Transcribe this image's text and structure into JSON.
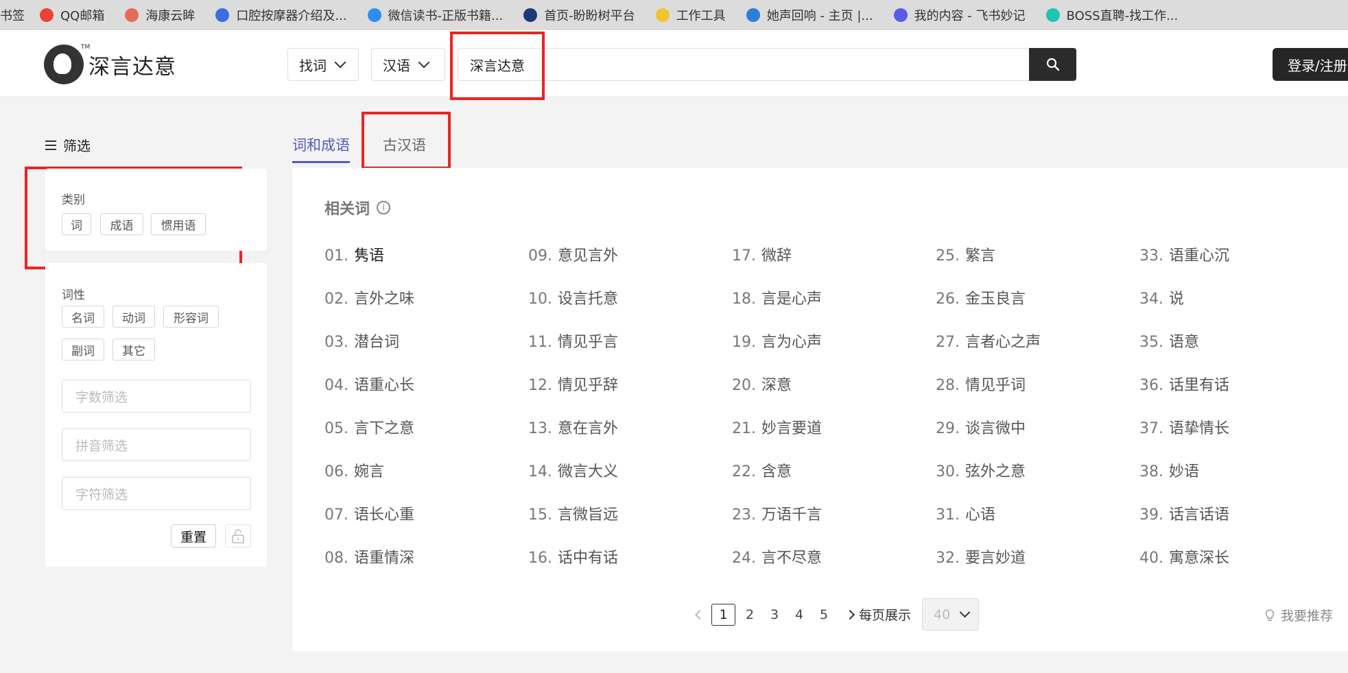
{
  "bookmarks": [
    {
      "label": "书签",
      "icon": "none",
      "color": ""
    },
    {
      "label": "QQ邮箱",
      "icon": "qq-mail-icon",
      "color": "#ea4335"
    },
    {
      "label": "海康云眸",
      "icon": "cloud-icon",
      "color": "#e56b5b"
    },
    {
      "label": "口腔按摩器介绍及...",
      "icon": "music-note-icon",
      "color": "#3b6fe0"
    },
    {
      "label": "微信读书-正版书籍...",
      "icon": "wechat-read-icon",
      "color": "#2e8ef0"
    },
    {
      "label": "首页-盼盼树平台",
      "icon": "robot-icon",
      "color": "#1c3a7a"
    },
    {
      "label": "工作工具",
      "icon": "folder-icon",
      "color": "#f2c230"
    },
    {
      "label": "她声回响 - 主页 |...",
      "icon": "leaf-icon",
      "color": "#2c7fd6"
    },
    {
      "label": "我的内容 - 飞书妙记",
      "icon": "feishu-icon",
      "color": "#5b5ce6"
    },
    {
      "label": "BOSS直聘-找工作...",
      "icon": "boss-icon",
      "color": "#20c4b0"
    }
  ],
  "header": {
    "logo_text": "深言达意",
    "logo_tm": "TM",
    "mode_select": "找词",
    "lang_select": "汉语",
    "search_value": "深言达意",
    "login_label": "登录/注册"
  },
  "sidebar": {
    "title": "筛选",
    "category": {
      "label": "类别",
      "tags": [
        "词",
        "成语",
        "惯用语"
      ]
    },
    "pos": {
      "label": "词性",
      "tags": [
        "名词",
        "动词",
        "形容词",
        "副词",
        "其它"
      ]
    },
    "inputs": {
      "char_count": "字数筛选",
      "pinyin": "拼音筛选",
      "char": "字符筛选"
    },
    "reset_label": "重置"
  },
  "tabs": {
    "active": "词和成语",
    "inactive": "古汉语"
  },
  "main": {
    "section_title": "相关词",
    "info_glyph": "i",
    "words": [
      {
        "num": "01.",
        "text": "隽语"
      },
      {
        "num": "02.",
        "text": "言外之味"
      },
      {
        "num": "03.",
        "text": "潜台词"
      },
      {
        "num": "04.",
        "text": "语重心长"
      },
      {
        "num": "05.",
        "text": "言下之意"
      },
      {
        "num": "06.",
        "text": "婉言"
      },
      {
        "num": "07.",
        "text": "语长心重"
      },
      {
        "num": "08.",
        "text": "语重情深"
      },
      {
        "num": "09.",
        "text": "意见言外"
      },
      {
        "num": "10.",
        "text": "设言托意"
      },
      {
        "num": "11.",
        "text": "情见乎言"
      },
      {
        "num": "12.",
        "text": "情见乎辞"
      },
      {
        "num": "13.",
        "text": "意在言外"
      },
      {
        "num": "14.",
        "text": "微言大义"
      },
      {
        "num": "15.",
        "text": "言微旨远"
      },
      {
        "num": "16.",
        "text": "话中有话"
      },
      {
        "num": "17.",
        "text": "微辞"
      },
      {
        "num": "18.",
        "text": "言是心声"
      },
      {
        "num": "19.",
        "text": "言为心声"
      },
      {
        "num": "20.",
        "text": "深意"
      },
      {
        "num": "21.",
        "text": "妙言要道"
      },
      {
        "num": "22.",
        "text": "含意"
      },
      {
        "num": "23.",
        "text": "万语千言"
      },
      {
        "num": "24.",
        "text": "言不尽意"
      },
      {
        "num": "25.",
        "text": "繁言"
      },
      {
        "num": "26.",
        "text": "金玉良言"
      },
      {
        "num": "27.",
        "text": "言者心之声"
      },
      {
        "num": "28.",
        "text": "情见乎词"
      },
      {
        "num": "29.",
        "text": "谈言微中"
      },
      {
        "num": "30.",
        "text": "弦外之意"
      },
      {
        "num": "31.",
        "text": "心语"
      },
      {
        "num": "32.",
        "text": "要言妙道"
      },
      {
        "num": "33.",
        "text": "语重心沉"
      },
      {
        "num": "34.",
        "text": "说"
      },
      {
        "num": "35.",
        "text": "语意"
      },
      {
        "num": "36.",
        "text": "话里有话"
      },
      {
        "num": "37.",
        "text": "语挚情长"
      },
      {
        "num": "38.",
        "text": "妙语"
      },
      {
        "num": "39.",
        "text": "话言话语"
      },
      {
        "num": "40.",
        "text": "寓意深长"
      }
    ]
  },
  "pagination": {
    "pages": [
      "1",
      "2",
      "3",
      "4",
      "5"
    ],
    "current": "1",
    "per_page_label": "每页展示",
    "per_page_value": "40"
  },
  "recommend_label": "我要推荐",
  "colors": {
    "accent": "#5a57c4",
    "annotation": "#ee2222",
    "dark_button": "#262626"
  }
}
